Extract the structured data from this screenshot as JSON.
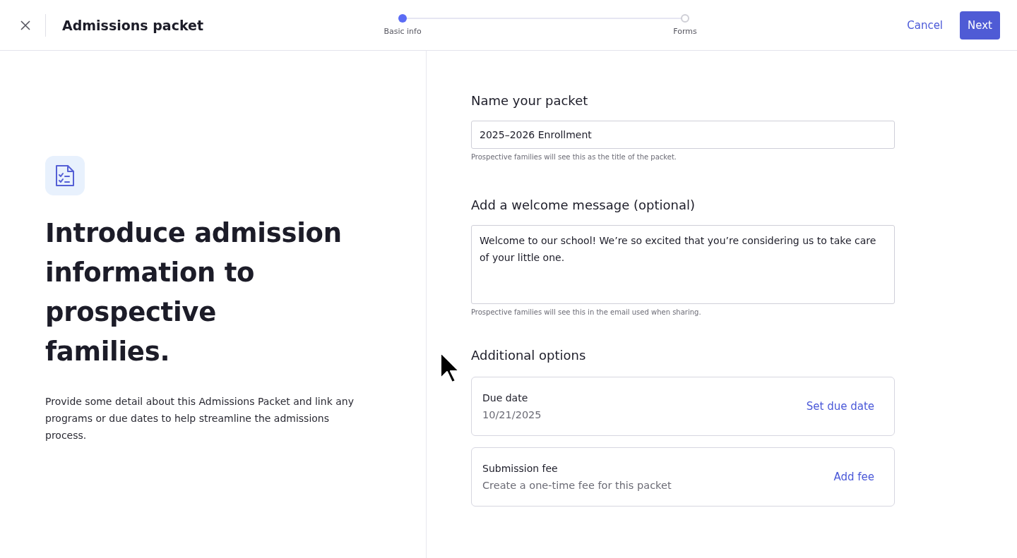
{
  "header": {
    "title": "Admissions packet",
    "cancel": "Cancel",
    "next": "Next"
  },
  "steps": [
    {
      "label": "Basic info",
      "selected": true
    },
    {
      "label": "Forms",
      "selected": false
    }
  ],
  "intro": {
    "heading": "Introduce admission information to prospective families.",
    "body": "Provide some detail about this Admissions Packet and link any programs or due dates to help streamline the admissions process."
  },
  "name_section": {
    "title": "Name your packet",
    "value": "2025–2026 Enrollment",
    "hint": "Prospective families will see this as the title of the packet."
  },
  "welcome_section": {
    "title": "Add a welcome message (optional)",
    "value": "Welcome to our school! We’re so excited that you’re considering us to take care of your little one.",
    "hint": "Prospective families will see this in the email used when sharing."
  },
  "options": {
    "title": "Additional options",
    "items": [
      {
        "label": "Due date",
        "detail": "10/21/2025",
        "action": "Set due date"
      },
      {
        "label": "Submission fee",
        "detail": "Create a one-time fee for this packet",
        "action": "Add fee"
      }
    ]
  }
}
